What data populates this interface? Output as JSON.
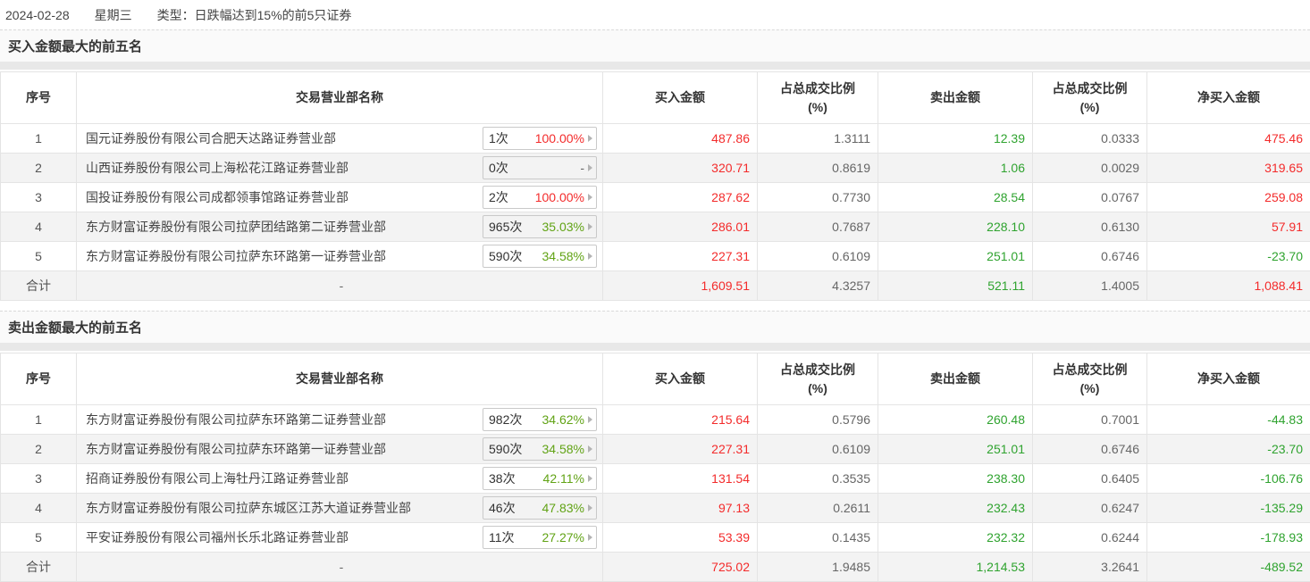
{
  "page": {
    "date": "2024-02-28",
    "weekday": "星期三",
    "type_label": "类型：",
    "type_value": "日跌幅达到15%的前5只证券"
  },
  "columns": [
    "序号",
    "交易营业部名称",
    "买入金额",
    "占总成交比例\n(%)",
    "卖出金额",
    "占总成交比例\n(%)",
    "净买入金额"
  ],
  "colors": {
    "red": "#f32b2b",
    "green": "#2fa32f",
    "badge_green": "#61a315"
  },
  "tables": [
    {
      "title": "买入金额最大的前五名",
      "rows": [
        {
          "num": "1",
          "name": "国元证券股份有限公司合肥天达路证券营业部",
          "visits": "1次",
          "win_rate": "100.00%",
          "buy": "487.86",
          "buy_ratio": "1.3111",
          "sell": "12.39",
          "sell_ratio": "0.0333",
          "net": "475.46"
        },
        {
          "num": "2",
          "name": "山西证券股份有限公司上海松花江路证券营业部",
          "visits": "0次",
          "win_rate": "-",
          "buy": "320.71",
          "buy_ratio": "0.8619",
          "sell": "1.06",
          "sell_ratio": "0.0029",
          "net": "319.65"
        },
        {
          "num": "3",
          "name": "国投证券股份有限公司成都领事馆路证券营业部",
          "visits": "2次",
          "win_rate": "100.00%",
          "buy": "287.62",
          "buy_ratio": "0.7730",
          "sell": "28.54",
          "sell_ratio": "0.0767",
          "net": "259.08"
        },
        {
          "num": "4",
          "name": "东方财富证券股份有限公司拉萨团结路第二证券营业部",
          "visits": "965次",
          "win_rate": "35.03%",
          "buy": "286.01",
          "buy_ratio": "0.7687",
          "sell": "228.10",
          "sell_ratio": "0.6130",
          "net": "57.91"
        },
        {
          "num": "5",
          "name": "东方财富证券股份有限公司拉萨东环路第一证券营业部",
          "visits": "590次",
          "win_rate": "34.58%",
          "buy": "227.31",
          "buy_ratio": "0.6109",
          "sell": "251.01",
          "sell_ratio": "0.6746",
          "net": "-23.70"
        },
        {
          "num": "合计",
          "name": "-",
          "visits": null,
          "win_rate": null,
          "buy": "1,609.51",
          "buy_ratio": "4.3257",
          "sell": "521.11",
          "sell_ratio": "1.4005",
          "net": "1,088.41"
        }
      ]
    },
    {
      "title": "卖出金额最大的前五名",
      "rows": [
        {
          "num": "1",
          "name": "东方财富证券股份有限公司拉萨东环路第二证券营业部",
          "visits": "982次",
          "win_rate": "34.62%",
          "buy": "215.64",
          "buy_ratio": "0.5796",
          "sell": "260.48",
          "sell_ratio": "0.7001",
          "net": "-44.83"
        },
        {
          "num": "2",
          "name": "东方财富证券股份有限公司拉萨东环路第一证券营业部",
          "visits": "590次",
          "win_rate": "34.58%",
          "buy": "227.31",
          "buy_ratio": "0.6109",
          "sell": "251.01",
          "sell_ratio": "0.6746",
          "net": "-23.70"
        },
        {
          "num": "3",
          "name": "招商证券股份有限公司上海牡丹江路证券营业部",
          "visits": "38次",
          "win_rate": "42.11%",
          "buy": "131.54",
          "buy_ratio": "0.3535",
          "sell": "238.30",
          "sell_ratio": "0.6405",
          "net": "-106.76"
        },
        {
          "num": "4",
          "name": "东方财富证券股份有限公司拉萨东城区江苏大道证券营业部",
          "visits": "46次",
          "win_rate": "47.83%",
          "buy": "97.13",
          "buy_ratio": "0.2611",
          "sell": "232.43",
          "sell_ratio": "0.6247",
          "net": "-135.29"
        },
        {
          "num": "5",
          "name": "平安证券股份有限公司福州长乐北路证券营业部",
          "visits": "11次",
          "win_rate": "27.27%",
          "buy": "53.39",
          "buy_ratio": "0.1435",
          "sell": "232.32",
          "sell_ratio": "0.6244",
          "net": "-178.93"
        },
        {
          "num": "合计",
          "name": "-",
          "visits": null,
          "win_rate": null,
          "buy": "725.02",
          "buy_ratio": "1.9485",
          "sell": "1,214.53",
          "sell_ratio": "3.2641",
          "net": "-489.52"
        }
      ]
    }
  ]
}
